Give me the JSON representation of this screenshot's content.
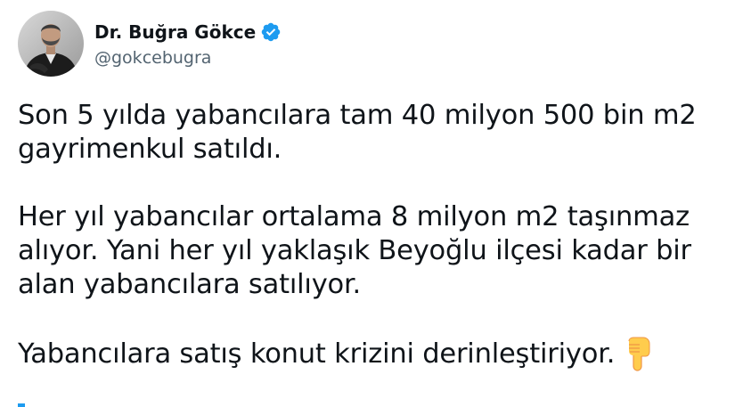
{
  "author": {
    "display_name": "Dr. Buğra Gökce",
    "handle": "@gokcebugra",
    "verified": true,
    "avatar_icon": "profile-photo",
    "verified_icon": "verified-badge-icon",
    "verified_color": "#1d9bf0"
  },
  "tweet": {
    "lines": {
      "p1_l1": "Son 5 yılda yabancılara tam 40 milyon 500 bin m2",
      "p1_l2": "gayrimenkul satıldı.",
      "p2_l1": "Her yıl yabancılar ortalama 8 milyon m2 taşınmaz",
      "p2_l2": "alıyor. Yani her yıl yaklaşık Beyoğlu ilçesi kadar bir",
      "p2_l3": "alan yabancılara satılıyor.",
      "p3_l1": "Yabancılara satış konut krizini derinleştiriyor."
    },
    "emoji": "pointing-down-hand-icon",
    "text_color": "#0f1419",
    "secondary_color": "#536471"
  }
}
